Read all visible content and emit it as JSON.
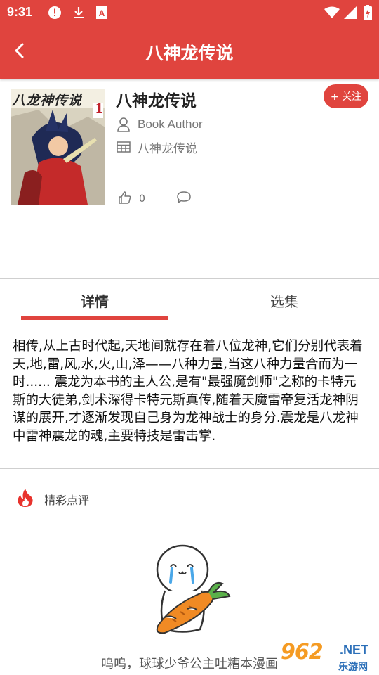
{
  "status_bar": {
    "time": "9:31",
    "icons": [
      "alert-icon",
      "download-icon",
      "notification-a-icon",
      "wifi-icon",
      "signal-icon",
      "battery-charging-icon"
    ]
  },
  "app_bar": {
    "title": "八神龙传说",
    "back_icon": "chevron-left-icon",
    "color": "#e0443e"
  },
  "book": {
    "cover_title": "八龙神传说",
    "cover_volume": "1",
    "title": "八神龙传说",
    "author": "Book Author",
    "category": "八神龙传说",
    "likes": "0",
    "follow_label": "+ 关注"
  },
  "tabs": {
    "items": [
      {
        "label": "详情",
        "active": true
      },
      {
        "label": "选集",
        "active": false
      }
    ]
  },
  "synopsis": "相传,从上古时代起,天地间就存在着八位龙神,它们分别代表着天,地,雷,风,水,火,山,泽——八种力量,当这八种力量合而为一时...... 震龙为本书的主人公,是有\"最强魔剑师\"之称的卡特元斯的大徒弟,剑术深得卡特元斯真传,随着天魔雷帝复活龙神阴谋的展开,才逐渐发现自己身为龙神战士的身分.震龙是八龙神中雷神震龙的魂,主要特技是雷击掌.",
  "reviews": {
    "title": "精彩点评",
    "empty_text": "呜呜，球球少爷公主吐糟本漫画"
  },
  "watermark": {
    "main": "962",
    "suffix": ".NET",
    "sub": "乐游网"
  }
}
